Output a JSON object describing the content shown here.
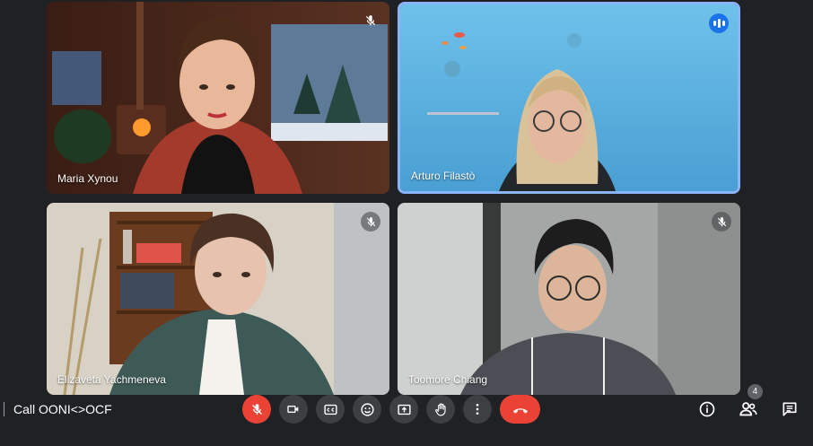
{
  "participants": [
    {
      "name": "Maria Xynou",
      "muted": true
    },
    {
      "name": "Arturo Filastò",
      "speaking": true
    },
    {
      "name": "Elizaveta Yachmeneva",
      "muted": true
    },
    {
      "name": "Toomore Chiang",
      "muted": true
    }
  ],
  "meeting": {
    "title": "Call OONI<>OCF"
  },
  "people_count": "4",
  "icons": {
    "mic": "mic-off-icon",
    "camera": "camera-icon",
    "captions": "closed-captions-icon",
    "emoji": "emoji-icon",
    "present": "present-screen-icon",
    "hand": "raise-hand-icon",
    "more": "more-options-icon",
    "end": "end-call-icon",
    "info": "info-icon",
    "people": "people-icon",
    "chat": "chat-icon"
  },
  "colors": {
    "accent": "#8ab4f8",
    "end_call": "#ea4335",
    "background": "#202124"
  }
}
